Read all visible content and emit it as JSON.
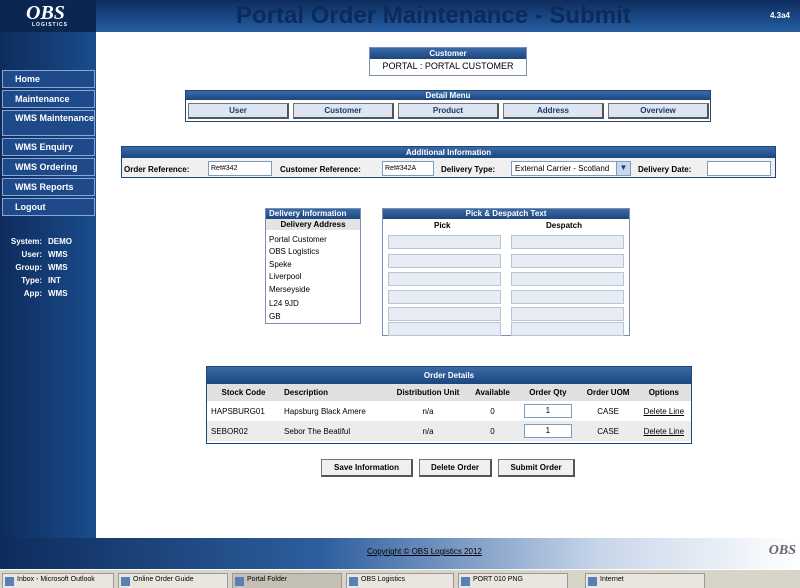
{
  "brand": {
    "logo_text": "OBS",
    "logo_sub": "LOGISTICS"
  },
  "header": {
    "title": "Portal Order Maintenance - Submit",
    "version": "4.3a4"
  },
  "sidebar": {
    "nav": [
      "Home",
      "Maintenance",
      "WMS Maintenance",
      "WMS Enquiry",
      "WMS Ordering",
      "WMS Reports",
      "Logout"
    ],
    "info": [
      {
        "k": "System:",
        "v": "DEMO"
      },
      {
        "k": "User:",
        "v": "WMS"
      },
      {
        "k": "Group:",
        "v": "WMS"
      },
      {
        "k": "Type:",
        "v": "INT"
      },
      {
        "k": "App:",
        "v": "WMS"
      }
    ]
  },
  "customer": {
    "header": "Customer",
    "value": "PORTAL : PORTAL CUSTOMER"
  },
  "detail_menu": {
    "header": "Detail Menu",
    "buttons": [
      "User",
      "Customer",
      "Product",
      "Address",
      "Overview"
    ]
  },
  "additional_info": {
    "header": "Additional Information",
    "order_reference_label": "Order Reference:",
    "order_reference_value": "Ref#342",
    "customer_reference_label": "Customer Reference:",
    "customer_reference_value": "Ref#342A",
    "delivery_type_label": "Delivery Type:",
    "delivery_type_value": "External Carrier - Scotland",
    "delivery_date_label": "Delivery Date:",
    "delivery_date_value": ""
  },
  "delivery_info": {
    "header": "Delivery Information",
    "sub_header": "Delivery Address",
    "lines": [
      "Portal Customer",
      "OBS Logistics",
      "Speke",
      "Liverpool",
      "Merseyside",
      "L24 9JD",
      "GB"
    ]
  },
  "pick_despatch": {
    "header": "Pick & Despatch Text",
    "pick_label": "Pick",
    "despatch_label": "Despatch"
  },
  "order_details": {
    "header": "Order Details",
    "columns": [
      "Stock Code",
      "Description",
      "Distribution Unit",
      "Available",
      "Order Qty",
      "Order UOM",
      "Options"
    ],
    "rows": [
      {
        "stock_code": "HAPSBURG01",
        "description": "Hapsburg Black Amere",
        "dist_unit": "n/a",
        "available": "0",
        "qty": "1",
        "uom": "CASE",
        "option": "Delete Line"
      },
      {
        "stock_code": "SEBOR02",
        "description": "Sebor The Beatiful",
        "dist_unit": "n/a",
        "available": "0",
        "qty": "1",
        "uom": "CASE",
        "option": "Delete Line"
      }
    ]
  },
  "actions": {
    "save": "Save Information",
    "delete": "Delete Order",
    "submit": "Submit Order"
  },
  "footer": {
    "copyright": "Copyright © OBS Logistics 2012",
    "logo": "OBS"
  },
  "taskbar": [
    "Inbox - Microsoft Outlook",
    "Online Order Guide",
    "Portal Folder",
    "OBS Logistics",
    "PORT 010 PNG",
    "Internet"
  ]
}
